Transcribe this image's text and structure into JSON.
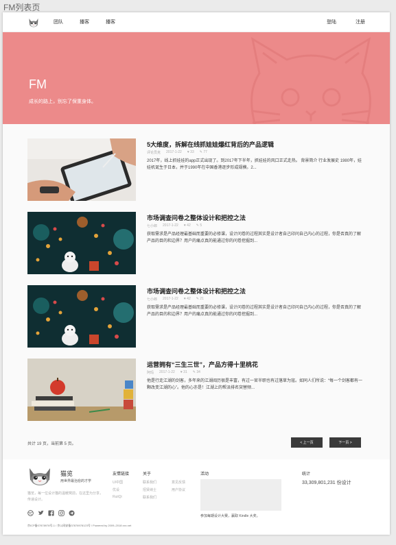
{
  "outer_label": "FM列表页",
  "nav": {
    "items": [
      "团队",
      "播客",
      "播客"
    ],
    "login": "登陆",
    "register": "注册"
  },
  "hero": {
    "title": "FM",
    "subtitle": "成长的路上，别忘了保重身体。",
    "bg_color": "#ec8a8a"
  },
  "articles": [
    {
      "title": "5大维度，拆解在线抓娃娃爆红背后的产品逻辑",
      "author": "评论员克",
      "date": "2017-1-22",
      "likes": "33",
      "comments": "77",
      "desc": "2017年，线上抓娃娃的app正式出现了。到2017年下半年，抓娃娃的风口正式走热。 背景简介 行业发展史 1980年，娃娃机诞生于日本，并于1990年在中国香港逐步形成规模。2..."
    },
    {
      "title": "市场调查问卷之整体设计和把控之法",
      "author": "七小郎",
      "date": "2017-1-22",
      "likes": "42",
      "comments": "5",
      "desc": "获取需求是产品经理最基础而重要的必修课，设计问卷的过程其实是设计者自己印问自己内心的过程，你是否真的了解产品的目的和边界？用户的痛点真的能通过你的问卷挖掘到..."
    },
    {
      "title": "市场调查问卷之整体设计和把控之法",
      "author": "七小郎",
      "date": "2017-1-22",
      "likes": "42",
      "comments": "21",
      "desc": "获取需求是产品经理最基础而重要的必修课，设计问卷的过程其实是设计者自己印问自己内心的过程，你是否真的了解产品的目的和边界？用户的痛点真的能通过你的问卷挖掘到..."
    },
    {
      "title": "运营拥有“三生三世”，产品方得十里桃花",
      "author": "阿玛",
      "date": "2017-1-22",
      "likes": "31",
      "comments": "34",
      "desc": "他是行走江湖的剑客，多年来的江湖阅历很是丰富，有过一官半职也有过落草为寇。如同人们所说：“每一个剑客都有一颗改变江湖的心”。他的心亦是！江湖上的帮派排名突替频..."
    }
  ],
  "pager": {
    "count": "共计 19 页，当前第 5 页。",
    "prev": "< 上一页",
    "next": "下一页 >"
  },
  "footer": {
    "brand": "猫览",
    "slogan": "用世界最治愈的才学",
    "intro": "猫览，每一位设计猫的温暖窝前，在这里为分享，传递设计。",
    "friends_title": "友情链接",
    "friends": [
      "UI中国",
      "优设",
      "RuiiQi"
    ],
    "about_title": "关于",
    "about_col1": [
      "联系我们",
      "招贤纳士",
      "联系我们"
    ],
    "about_col2": [
      "意见反馈",
      "用户协议"
    ],
    "activity_title": "活动",
    "activity_text": "参加每期设计大赛，赢取 Kindle 大奖。",
    "stats_title": "统计",
    "stats_value": "33,309,801,231 份设计",
    "copyright": "京ICP备07878978号-1 / 京公网安备37878978123号 / Powered by 2009–2018 xxx.net"
  }
}
